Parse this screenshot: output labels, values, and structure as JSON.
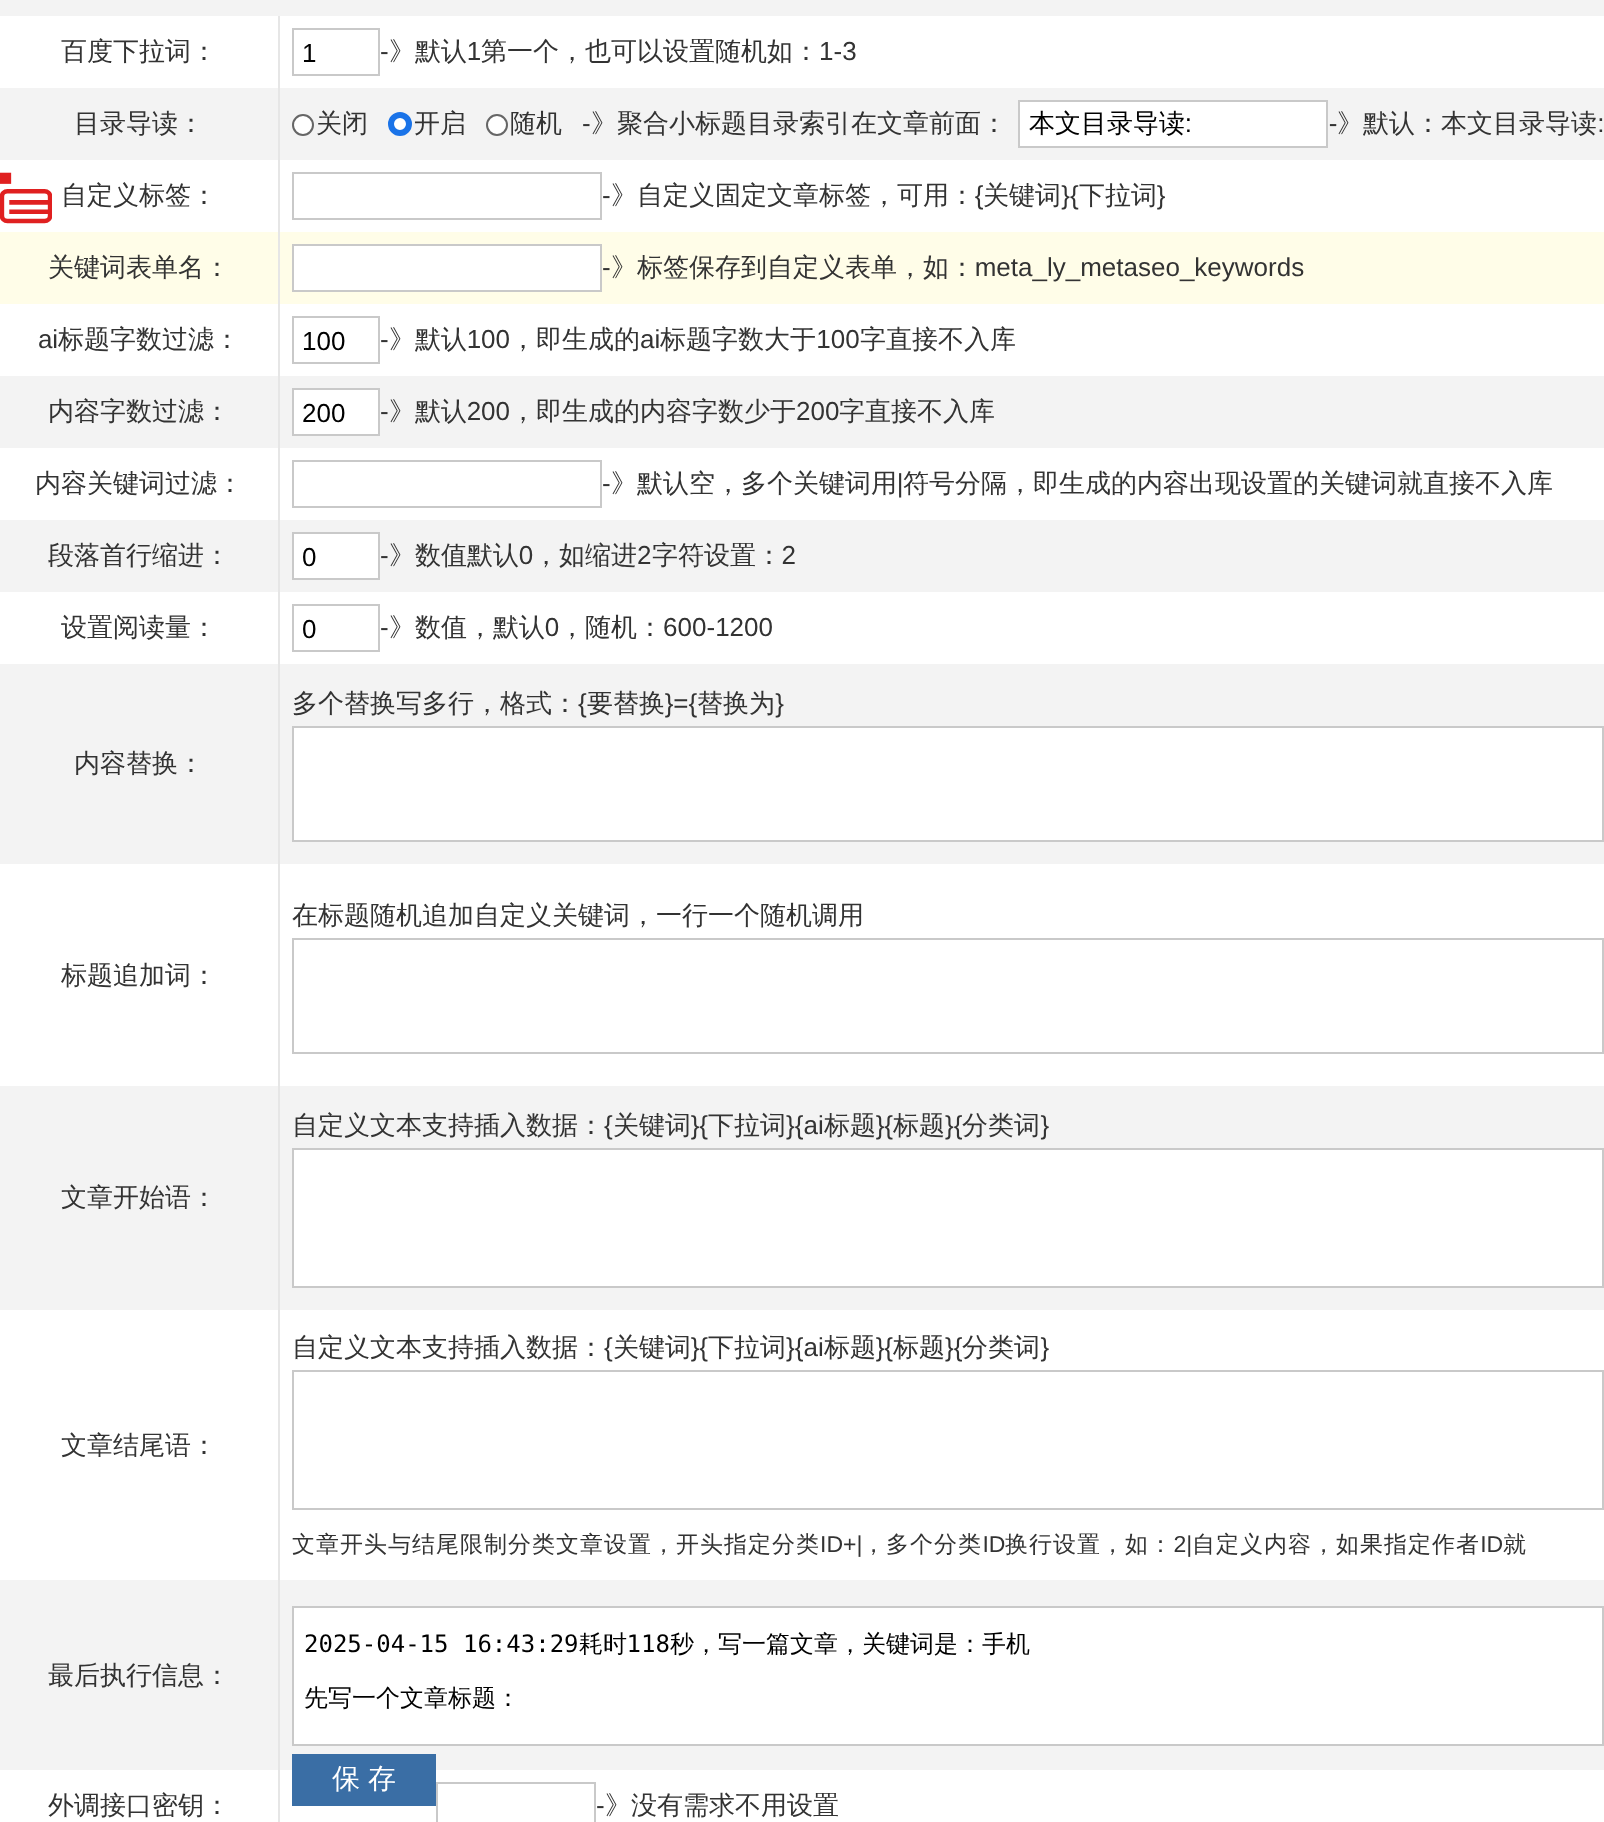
{
  "rows": [
    {
      "kind": "number",
      "label": "百度下拉词：",
      "highlighted": false,
      "value": "1",
      "hint": "-》默认1第一个，也可以设置随机如：1-3"
    },
    {
      "kind": "radio",
      "label": "目录导读：",
      "highlighted": false,
      "options": [
        {
          "label": "关闭",
          "selected": false
        },
        {
          "label": "开启",
          "selected": true
        },
        {
          "label": "随机",
          "selected": false
        }
      ],
      "hint": "-》聚合小标题目录索引在文章前面：",
      "value": "本文目录导读:",
      "hint_after": "-》默认：本文目录导读:"
    },
    {
      "kind": "text",
      "label": "自定义标签：",
      "highlighted": false,
      "value": "",
      "hint": "-》自定义固定文章标签，可用：{关键词}{下拉词}"
    },
    {
      "kind": "text",
      "label": "关键词表单名：",
      "highlighted": true,
      "value": "",
      "hint": "-》标签保存到自定义表单，如：meta_ly_metaseo_keywords"
    },
    {
      "kind": "number",
      "label": "ai标题字数过滤：",
      "highlighted": false,
      "value": "100",
      "hint": "-》默认100，即生成的ai标题字数大于100字直接不入库"
    },
    {
      "kind": "number",
      "label": "内容字数过滤：",
      "highlighted": false,
      "value": "200",
      "hint": "-》默认200，即生成的内容字数少于200字直接不入库"
    },
    {
      "kind": "text",
      "label": "内容关键词过滤：",
      "highlighted": false,
      "value": "",
      "hint": "-》默认空，多个关键词用|符号分隔，即生成的内容出现设置的关键词就直接不入库"
    },
    {
      "kind": "number",
      "label": "段落首行缩进：",
      "highlighted": false,
      "value": "0",
      "hint": "-》数值默认0，如缩进2字符设置：2"
    },
    {
      "kind": "number",
      "label": "设置阅读量：",
      "highlighted": false,
      "value": "0",
      "hint": "-》数值，默认0，随机：600-1200"
    },
    {
      "kind": "textarea",
      "label": "内容替换：",
      "highlighted": false,
      "note": "多个替换写多行，格式：{要替换}={替换为}",
      "value": ""
    },
    {
      "kind": "textarea",
      "label": "标题追加词：",
      "highlighted": false,
      "note": "在标题随机追加自定义关键词，一行一个随机调用",
      "value": ""
    },
    {
      "kind": "textarea",
      "label": "文章开始语：",
      "highlighted": false,
      "note": "自定义文本支持插入数据：{关键词}{下拉词}{ai标题}{标题}{分类词}",
      "value": ""
    },
    {
      "kind": "textarea",
      "label": "文章结尾语：",
      "highlighted": false,
      "note": "自定义文本支持插入数据：{关键词}{下拉词}{ai标题}{标题}{分类词}",
      "value": "",
      "note_after": "文章开头与结尾限制分类文章设置，开头指定分类ID+|，多个分类ID换行设置，如：2|自定义内容，如果指定作者ID就"
    },
    {
      "kind": "log",
      "label": "最后执行信息：",
      "highlighted": false,
      "lines": [
        "2025-04-15 16:43:29耗时118秒，写一篇文章，关键词是：手机",
        "先写一个文章标题："
      ]
    },
    {
      "kind": "text",
      "label": "外调接口密钥：",
      "highlighted": false,
      "value": "",
      "hint": "-》没有需求不用设置"
    }
  ],
  "save_button": "保存"
}
